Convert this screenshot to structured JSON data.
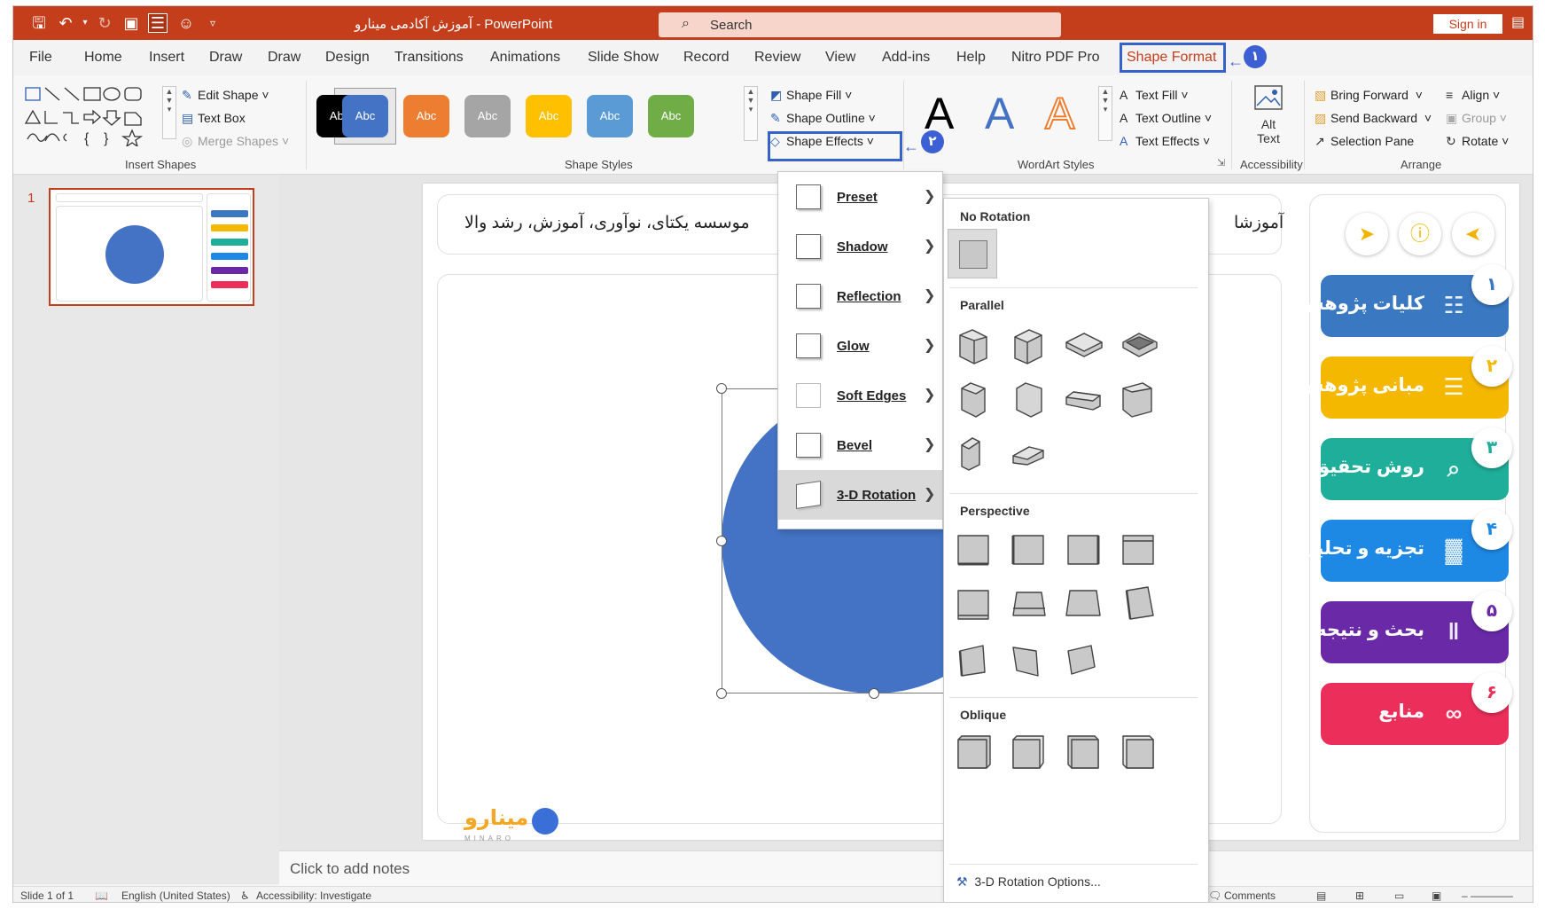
{
  "window": {
    "title": "آموزش آکادمی مینارو  -  PowerPoint",
    "search_placeholder": "Search",
    "sign_in": "Sign in"
  },
  "tabs": [
    "File",
    "Home",
    "Insert",
    "Draw",
    "Draw",
    "Design",
    "Transitions",
    "Animations",
    "Slide Show",
    "Record",
    "Review",
    "View",
    "Add-ins",
    "Help",
    "Nitro PDF Pro",
    "Shape Format"
  ],
  "active_tab": "Shape Format",
  "callouts": {
    "one": "۱",
    "two": "۲"
  },
  "ribbon": {
    "insert_shapes": {
      "label": "Insert Shapes",
      "edit_shape": "Edit Shape",
      "text_box": "Text Box",
      "merge_shapes": "Merge Shapes"
    },
    "shape_styles": {
      "label": "Shape Styles",
      "swatches": [
        {
          "text": "Abc",
          "color": "#000000"
        },
        {
          "text": "Abc",
          "color": "#4472c4"
        },
        {
          "text": "Abc",
          "color": "#ed7d31"
        },
        {
          "text": "Abc",
          "color": "#a5a5a5"
        },
        {
          "text": "Abc",
          "color": "#ffc000"
        },
        {
          "text": "Abc",
          "color": "#5b9bd5"
        },
        {
          "text": "Abc",
          "color": "#70ad47"
        }
      ],
      "shape_fill": "Shape Fill",
      "shape_outline": "Shape Outline",
      "shape_effects": "Shape Effects"
    },
    "wordart": {
      "label": "WordArt Styles",
      "letters": [
        "A",
        "A",
        "A"
      ],
      "text_fill": "Text Fill",
      "text_outline": "Text Outline",
      "text_effects": "Text Effects"
    },
    "accessibility": {
      "label": "Accessibility",
      "alt_text_line1": "Alt",
      "alt_text_line2": "Text"
    },
    "arrange": {
      "label": "Arrange",
      "bring_forward": "Bring Forward",
      "send_backward": "Send Backward",
      "selection_pane": "Selection Pane",
      "align": "Align",
      "group": "Group",
      "rotate": "Rotate"
    }
  },
  "thumbnail": {
    "number": "1"
  },
  "slide": {
    "header_text": "موسسه یکتای، نوآوری، آموزش، رشد والا",
    "header_right": "آموزشا",
    "logo_text": "مینارو",
    "logo_sub": "MINARO",
    "menu": [
      {
        "num": "۱",
        "label": "کلیات پژوهش",
        "color": "#3a78c2"
      },
      {
        "num": "۲",
        "label": "مبانی پژوهش",
        "color": "#f5b800"
      },
      {
        "num": "۳",
        "label": "روش تحقیق",
        "color": "#1fae9a"
      },
      {
        "num": "۴",
        "label": "تجزیه و تحلیل",
        "color": "#1e88e5"
      },
      {
        "num": "۵",
        "label": "بحث و نتیجه",
        "color": "#6a2aa8"
      },
      {
        "num": "۶",
        "label": "منابع",
        "color": "#ec2f5a"
      }
    ]
  },
  "notes_placeholder": "Click to add notes",
  "status": {
    "slide": "Slide 1 of 1",
    "language": "English (United States)",
    "accessibility": "Accessibility: Investigate",
    "comments": "Comments"
  },
  "effects_menu": {
    "items": [
      "Preset",
      "Shadow",
      "Reflection",
      "Glow",
      "Soft Edges",
      "Bevel",
      "3-D Rotation"
    ],
    "active": "3-D Rotation"
  },
  "rotation_gallery": {
    "sections": [
      "No Rotation",
      "Parallel",
      "Perspective",
      "Oblique"
    ],
    "options_link": "3-D Rotation Options..."
  }
}
